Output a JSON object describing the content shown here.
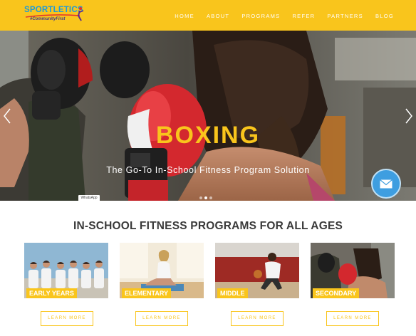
{
  "header": {
    "logo_text": "SPORTLETICS",
    "logo_tagline": "#CommunityFirst",
    "nav": [
      "HOME",
      "ABOUT",
      "PROGRAMS",
      "REFER",
      "PARTNERS",
      "BLOG"
    ]
  },
  "hero": {
    "title": "BOXING",
    "subtitle": "The Go-To In-School Fitness Program Solution",
    "slide_count": 3,
    "active_slide": 2,
    "whatsapp_label": "WhatsApp"
  },
  "programs": {
    "title": "IN-SCHOOL FITNESS PROGRAMS FOR ALL AGES",
    "cards": [
      {
        "label": "EARLY YEARS",
        "button": "LEARN MORE"
      },
      {
        "label": "ELEMENTARY",
        "button": "LEARN MORE"
      },
      {
        "label": "MIDDLE",
        "button": "LEARN MORE"
      },
      {
        "label": "SECONDARY",
        "button": "LEARN MORE"
      }
    ]
  },
  "colors": {
    "brand_yellow": "#f9c51c",
    "brand_blue": "#1f9bd7",
    "mail_blue": "#3e9ee0"
  }
}
